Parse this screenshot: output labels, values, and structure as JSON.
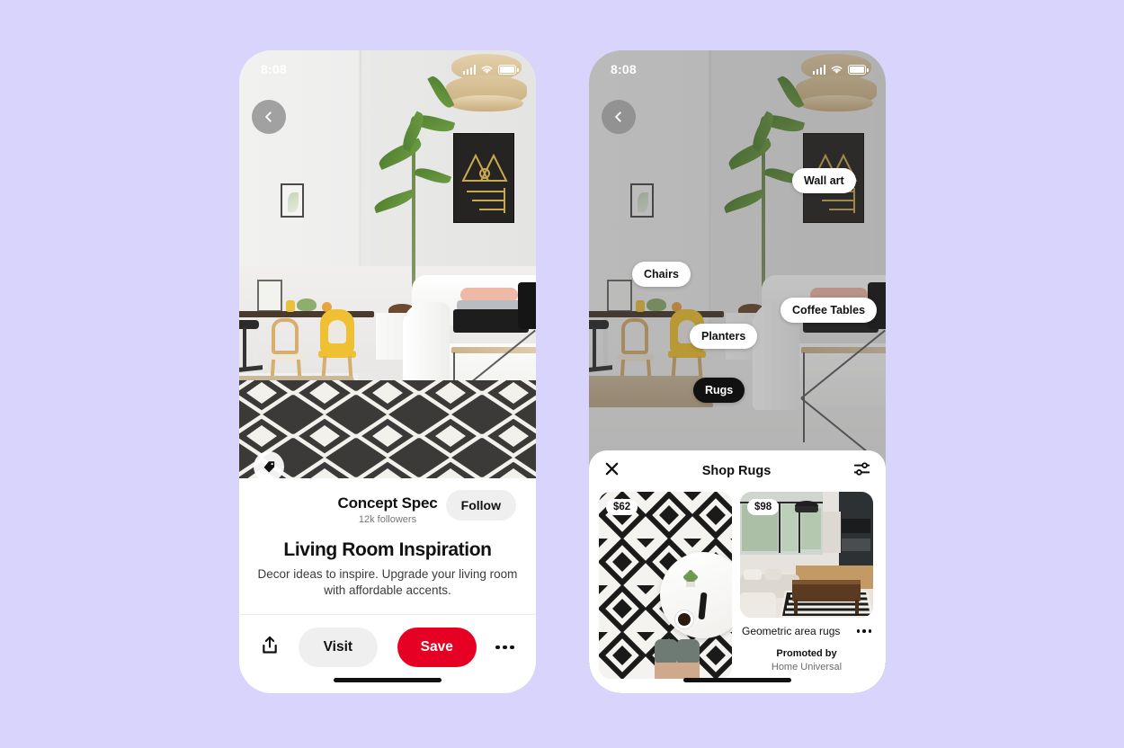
{
  "background_color": "#d9d4fc",
  "phones": {
    "left": {
      "status_bar": {
        "time": "8:08",
        "signal_icon": "cellular-bars-icon",
        "wifi_icon": "wifi-icon",
        "battery_icon": "battery-full-icon"
      },
      "back_button_icon": "chevron-left-icon",
      "shop_tag_icon": "price-tag-icon",
      "creator": {
        "name": "Concept Spec",
        "followers": "12k followers",
        "follow_label": "Follow"
      },
      "pin": {
        "title": "Living Room Inspiration",
        "description": "Decor ideas to inspire. Upgrade your living room with affordable accents."
      },
      "actions": {
        "share_icon": "share-upload-icon",
        "visit_label": "Visit",
        "save_label": "Save",
        "more_icon": "more-horizontal-icon",
        "save_color": "#e60023",
        "visit_color": "#efefef"
      }
    },
    "right": {
      "status_bar": {
        "time": "8:08",
        "signal_icon": "cellular-bars-icon",
        "wifi_icon": "wifi-icon",
        "battery_icon": "battery-full-icon"
      },
      "back_button_icon": "chevron-left-icon",
      "hotspot_labels": [
        {
          "label": "Wall art",
          "selected": false
        },
        {
          "label": "Chairs",
          "selected": false
        },
        {
          "label": "Coffee Tables",
          "selected": false
        },
        {
          "label": "Planters",
          "selected": false
        },
        {
          "label": "Rugs",
          "selected": true
        }
      ],
      "shop_sheet": {
        "close_icon": "close-x-icon",
        "title": "Shop Rugs",
        "filter_icon": "filter-sliders-icon",
        "products": [
          {
            "price": "$62",
            "name": "",
            "image": "black-white-geometric-rug-overhead"
          },
          {
            "price": "$98",
            "name": "Geometric area rugs",
            "image": "modern-living-room-with-rug",
            "more_icon": "more-horizontal-icon",
            "promoted_by_label": "Promoted by",
            "promoted_brand": "Home Universal"
          }
        ]
      }
    }
  }
}
